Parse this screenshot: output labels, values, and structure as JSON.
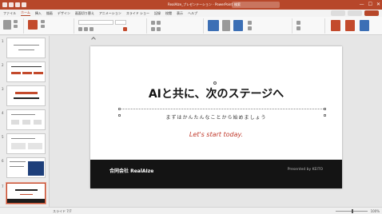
{
  "window": {
    "doc_title": "RealAIze_プレゼンテーション - PowerPoint",
    "search_placeholder": "検索",
    "controls": [
      "—",
      "☐",
      "✕"
    ]
  },
  "ribbon_tabs": [
    "ファイル",
    "ホーム",
    "挿入",
    "描画",
    "デザイン",
    "画面切り替え",
    "アニメーション",
    "スライド ショー",
    "記録",
    "校閲",
    "表示",
    "ヘルプ"
  ],
  "slide_panel": {
    "numbers": [
      "1",
      "2",
      "3",
      "4",
      "5",
      "6",
      "7"
    ]
  },
  "slide": {
    "title": "AIと共に、次のステージへ",
    "subtitle": "まずはかんたんなことから始めましょう",
    "cta": "Let's start today.",
    "company": "合同会社 RealAIze",
    "presented_by": "Presented by KEITO"
  },
  "status_bar": {
    "left": "スライド 7/7",
    "right": "100%"
  },
  "colors": {
    "accent": "#b7472a",
    "cta": "#c0392b",
    "footer": "#141414"
  }
}
